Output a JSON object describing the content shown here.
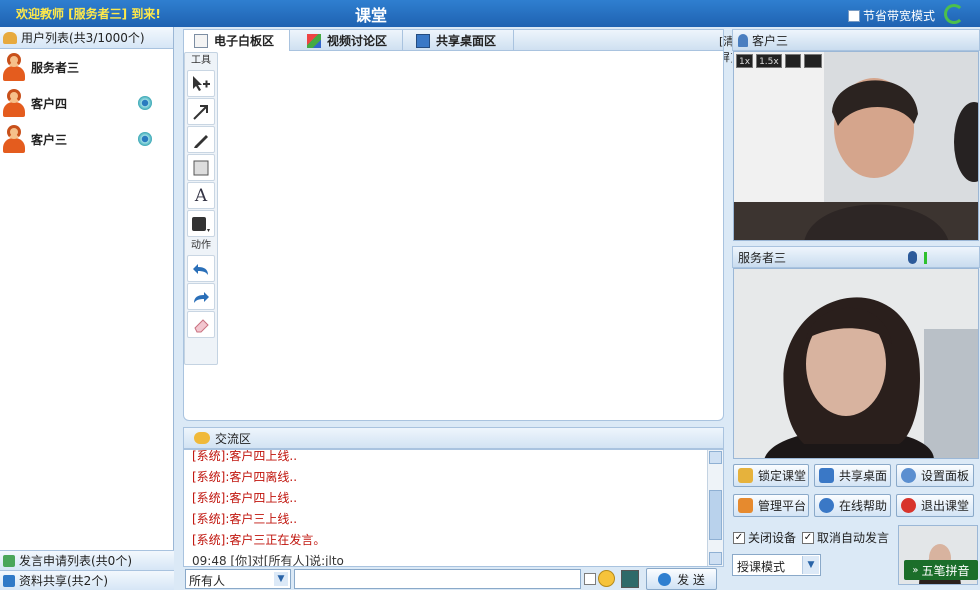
{
  "header": {
    "welcome": "欢迎教师 [服务者三] 到来!",
    "title": "课堂",
    "bandwidth_mode": "节省带宽模式"
  },
  "user_list": {
    "title": "用户列表(共3/1000个)",
    "users": [
      {
        "name": "服务者三",
        "has_camera": false
      },
      {
        "name": "客户四",
        "has_camera": true
      },
      {
        "name": "客户三",
        "has_camera": true
      }
    ]
  },
  "speak_requests": {
    "title": "发言申请列表(共0个)"
  },
  "file_share": {
    "title": "资料共享(共2个)"
  },
  "tabs": [
    {
      "label": "电子白板区",
      "active": true
    },
    {
      "label": "视频讨论区",
      "active": false
    },
    {
      "label": "共享桌面区",
      "active": false
    }
  ],
  "board_toolbar": {
    "clear_label": "[清屏]"
  },
  "toolbox": {
    "tools_label": "工具",
    "actions_label": "动作",
    "tools": [
      "A"
    ]
  },
  "chat": {
    "title": "交流区",
    "messages": [
      {
        "text": "[系统]:客户四上线..",
        "kind": "system"
      },
      {
        "text": "[系统]:客户四离线..",
        "kind": "system"
      },
      {
        "text": "[系统]:客户四上线..",
        "kind": "system"
      },
      {
        "text": "[系统]:客户三上线..",
        "kind": "system"
      },
      {
        "text": "[系统]:客户三正在发言。",
        "kind": "system"
      },
      {
        "text": "09:48 [你]对[所有人]说:jlto",
        "kind": "user"
      }
    ],
    "target": "所有人",
    "input_value": "",
    "send_label": "发 送"
  },
  "videos": [
    {
      "name": "客户三",
      "zoom_options": [
        "1x",
        "1.5x"
      ]
    },
    {
      "name": "服务者三"
    }
  ],
  "controls": {
    "lock_room": "锁定课堂",
    "share_desktop": "共享桌面",
    "settings_panel": "设置面板",
    "admin_platform": "管理平台",
    "online_help": "在线帮助",
    "exit_room": "退出课堂",
    "close_device": "关闭设备",
    "cancel_auto_speak": "取消自动发言",
    "mode": "授课模式"
  },
  "ime": {
    "label": "五笔拼音"
  },
  "colors": {
    "topbar": "#1f62b1",
    "welcome_text": "#ffe94a",
    "system_message": "#c0140c",
    "panel_bg": "#dbe9f6"
  }
}
